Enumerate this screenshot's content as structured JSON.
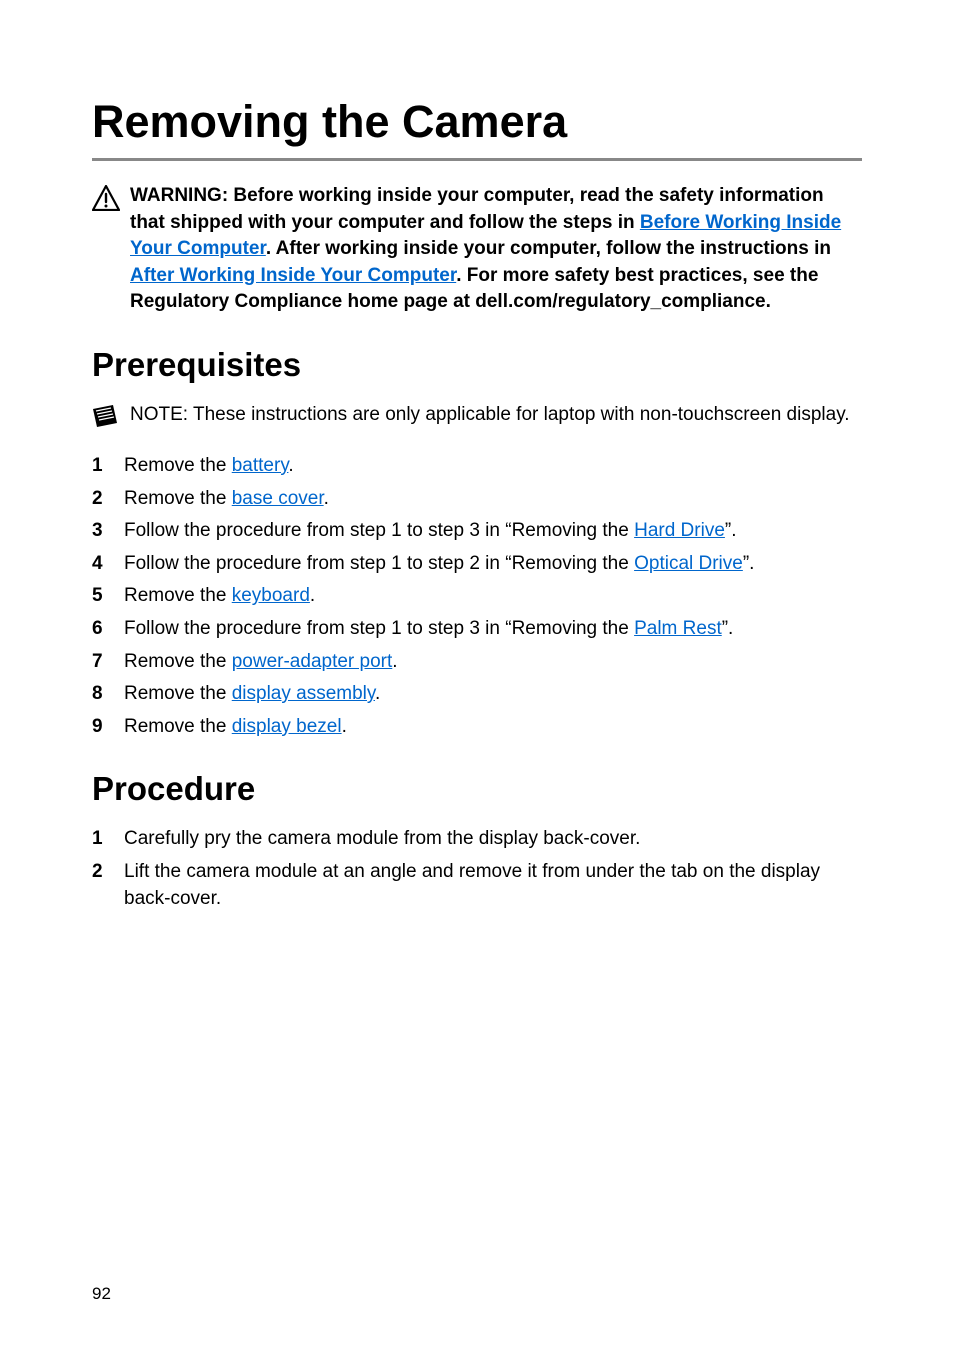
{
  "title": "Removing the Camera",
  "warning": {
    "label": "WARNING:",
    "p1": " Before working inside your computer, read the safety information that shipped with your computer and follow the steps in ",
    "link1": "Before Working Inside Your Computer",
    "p2": ". After working inside your computer, follow the instructions in ",
    "link2": "After Working Inside Your Computer",
    "p3": ". For more safety best practices, see the Regulatory Compliance home page at dell.com/regulatory_compliance."
  },
  "prereq": {
    "heading": "Prerequisites",
    "note_label": "NOTE:",
    "note_text": " These instructions are only applicable for laptop with non-touchscreen display.",
    "s1a": "Remove the ",
    "s1l": "battery",
    "s1b": ".",
    "s2a": "Remove the ",
    "s2l": "base cover",
    "s2b": ".",
    "s3a": "Follow the procedure from step 1 to step 3 in “Removing the ",
    "s3l": "Hard Drive",
    "s3b": "”.",
    "s4a": "Follow the procedure from step 1 to step 2 in “Removing the ",
    "s4l": "Optical Drive",
    "s4b": "”.",
    "s5a": "Remove the ",
    "s5l": "keyboard",
    "s5b": ".",
    "s6a": "Follow the procedure from step 1 to step 3 in “Removing the ",
    "s6l": "Palm Rest",
    "s6b": "”.",
    "s7a": "Remove the ",
    "s7l": "power-adapter port",
    "s7b": ".",
    "s8a": "Remove the ",
    "s8l": "display assembly",
    "s8b": ".",
    "s9a": "Remove the ",
    "s9l": "display bezel",
    "s9b": "."
  },
  "procedure": {
    "heading": "Procedure",
    "s1": "Carefully pry the camera module from the display back-cover.",
    "s2": "Lift the camera module at an angle and remove it from under the tab on the display back-cover."
  },
  "page_number": "92"
}
